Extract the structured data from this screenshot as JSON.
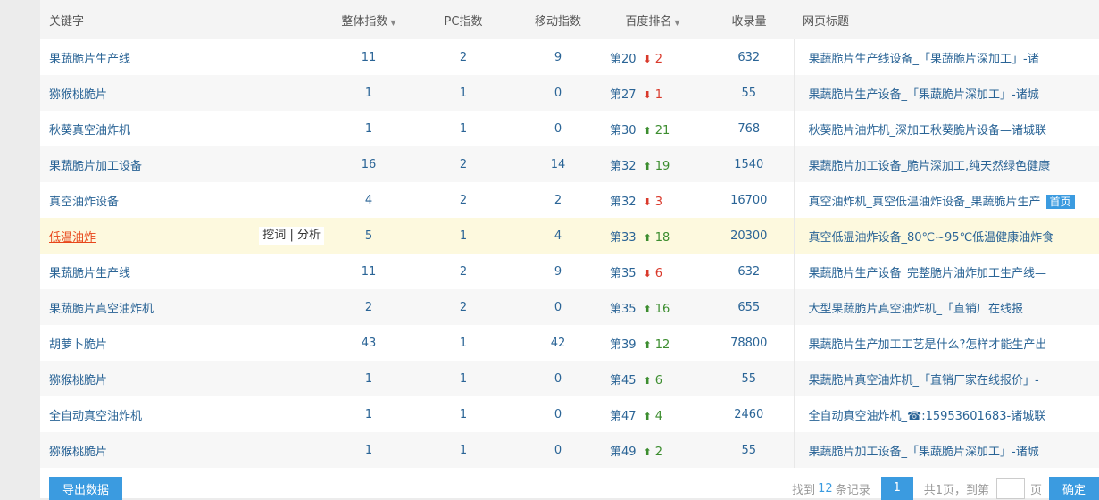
{
  "columns": {
    "keyword": "关键字",
    "overall": "整体指数",
    "pc": "PC指数",
    "mobile": "移动指数",
    "rank": "百度排名",
    "indexed": "收录量",
    "title": "网页标题"
  },
  "row_tools": {
    "mine": "挖词",
    "sep": "|",
    "analyze": "分析"
  },
  "rows": [
    {
      "keyword": "果蔬脆片生产线",
      "overall": "11",
      "pc": "2",
      "mobile": "9",
      "rank": "第20",
      "dir": "down",
      "change": "2",
      "indexed": "632",
      "title": "果蔬脆片生产线设备_「果蔬脆片深加工」-诸",
      "badge": ""
    },
    {
      "keyword": "猕猴桃脆片",
      "overall": "1",
      "pc": "1",
      "mobile": "0",
      "rank": "第27",
      "dir": "down",
      "change": "1",
      "indexed": "55",
      "title": "果蔬脆片生产设备_「果蔬脆片深加工」-诸城",
      "badge": ""
    },
    {
      "keyword": "秋葵真空油炸机",
      "overall": "1",
      "pc": "1",
      "mobile": "0",
      "rank": "第30",
      "dir": "up",
      "change": "21",
      "indexed": "768",
      "title": "秋葵脆片油炸机_深加工秋葵脆片设备—诸城联",
      "badge": ""
    },
    {
      "keyword": "果蔬脆片加工设备",
      "overall": "16",
      "pc": "2",
      "mobile": "14",
      "rank": "第32",
      "dir": "up",
      "change": "19",
      "indexed": "1540",
      "title": "果蔬脆片加工设备_脆片深加工,纯天然绿色健康",
      "badge": ""
    },
    {
      "keyword": "真空油炸设备",
      "overall": "4",
      "pc": "2",
      "mobile": "2",
      "rank": "第32",
      "dir": "down",
      "change": "3",
      "indexed": "16700",
      "title": "真空油炸机_真空低温油炸设备_果蔬脆片生产",
      "badge": "首页"
    },
    {
      "keyword": "低温油炸",
      "overall": "5",
      "pc": "1",
      "mobile": "4",
      "rank": "第33",
      "dir": "up",
      "change": "18",
      "indexed": "20300",
      "title": "真空低温油炸设备_80℃~95℃低温健康油炸食",
      "badge": ""
    },
    {
      "keyword": "果蔬脆片生产线",
      "overall": "11",
      "pc": "2",
      "mobile": "9",
      "rank": "第35",
      "dir": "down",
      "change": "6",
      "indexed": "632",
      "title": "果蔬脆片生产设备_完整脆片油炸加工生产线—",
      "badge": ""
    },
    {
      "keyword": "果蔬脆片真空油炸机",
      "overall": "2",
      "pc": "2",
      "mobile": "0",
      "rank": "第35",
      "dir": "up",
      "change": "16",
      "indexed": "655",
      "title": "大型果蔬脆片真空油炸机_「直销厂在线报",
      "badge": ""
    },
    {
      "keyword": "胡萝卜脆片",
      "overall": "43",
      "pc": "1",
      "mobile": "42",
      "rank": "第39",
      "dir": "up",
      "change": "12",
      "indexed": "78800",
      "title": "果蔬脆片生产加工工艺是什么?怎样才能生产出",
      "badge": ""
    },
    {
      "keyword": "猕猴桃脆片",
      "overall": "1",
      "pc": "1",
      "mobile": "0",
      "rank": "第45",
      "dir": "up",
      "change": "6",
      "indexed": "55",
      "title": "果蔬脆片真空油炸机_「直销厂家在线报价」-",
      "badge": ""
    },
    {
      "keyword": "全自动真空油炸机",
      "overall": "1",
      "pc": "1",
      "mobile": "0",
      "rank": "第47",
      "dir": "up",
      "change": "4",
      "indexed": "2460",
      "title": "全自动真空油炸机_☎:15953601683-诸城联",
      "badge": ""
    },
    {
      "keyword": "猕猴桃脆片",
      "overall": "1",
      "pc": "1",
      "mobile": "0",
      "rank": "第49",
      "dir": "up",
      "change": "2",
      "indexed": "55",
      "title": "果蔬脆片加工设备_「果蔬脆片深加工」-诸城",
      "badge": ""
    }
  ],
  "footer": {
    "export_label": "导出数据",
    "found_prefix": "找到",
    "found_count": "12",
    "found_suffix": "条记录",
    "current_page": "1",
    "total_pages_text": "共1页，到第",
    "page_unit": "页",
    "confirm_label": "确定"
  }
}
